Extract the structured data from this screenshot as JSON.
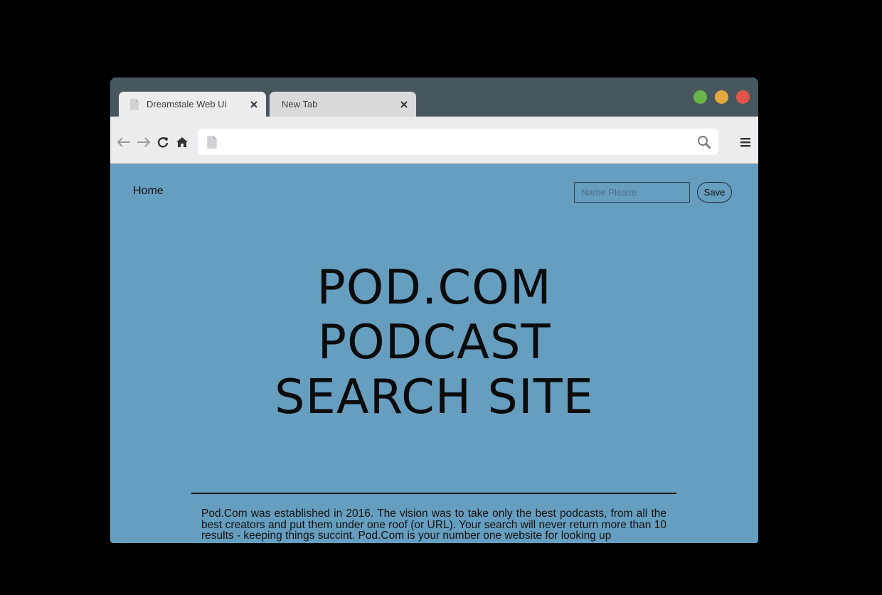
{
  "browser": {
    "tabs": [
      {
        "label": "Dreamstale Web Ui",
        "active": true
      },
      {
        "label": "New Tab",
        "active": false
      }
    ],
    "address_bar": {
      "value": ""
    },
    "window_controls": {
      "green": "#6ab64a",
      "yellow": "#e5a83f",
      "red": "#e1544a"
    }
  },
  "page": {
    "nav": {
      "home_label": "Home"
    },
    "name_field": {
      "placeholder": "Name Please",
      "value": ""
    },
    "save_label": "Save",
    "hero": {
      "lines": [
        "POD.COM",
        "PODCAST",
        "SEARCH SITE"
      ]
    },
    "about_text": "Pod.Com was established in 2016. The vision was to take only the best podcasts, from all the best creators and put them under one roof (or URL). Your search will never return more than 10 results - keeping things succint. Pod.Com is your number one website for looking up"
  },
  "colors": {
    "page_background": "#669ec0",
    "titlebar": "#48575e",
    "toolbar": "#ececee"
  },
  "icons": [
    "document-icon",
    "close-icon",
    "back-arrow-icon",
    "forward-arrow-icon",
    "reload-icon",
    "home-icon",
    "search-icon",
    "hamburger-menu-icon"
  ]
}
